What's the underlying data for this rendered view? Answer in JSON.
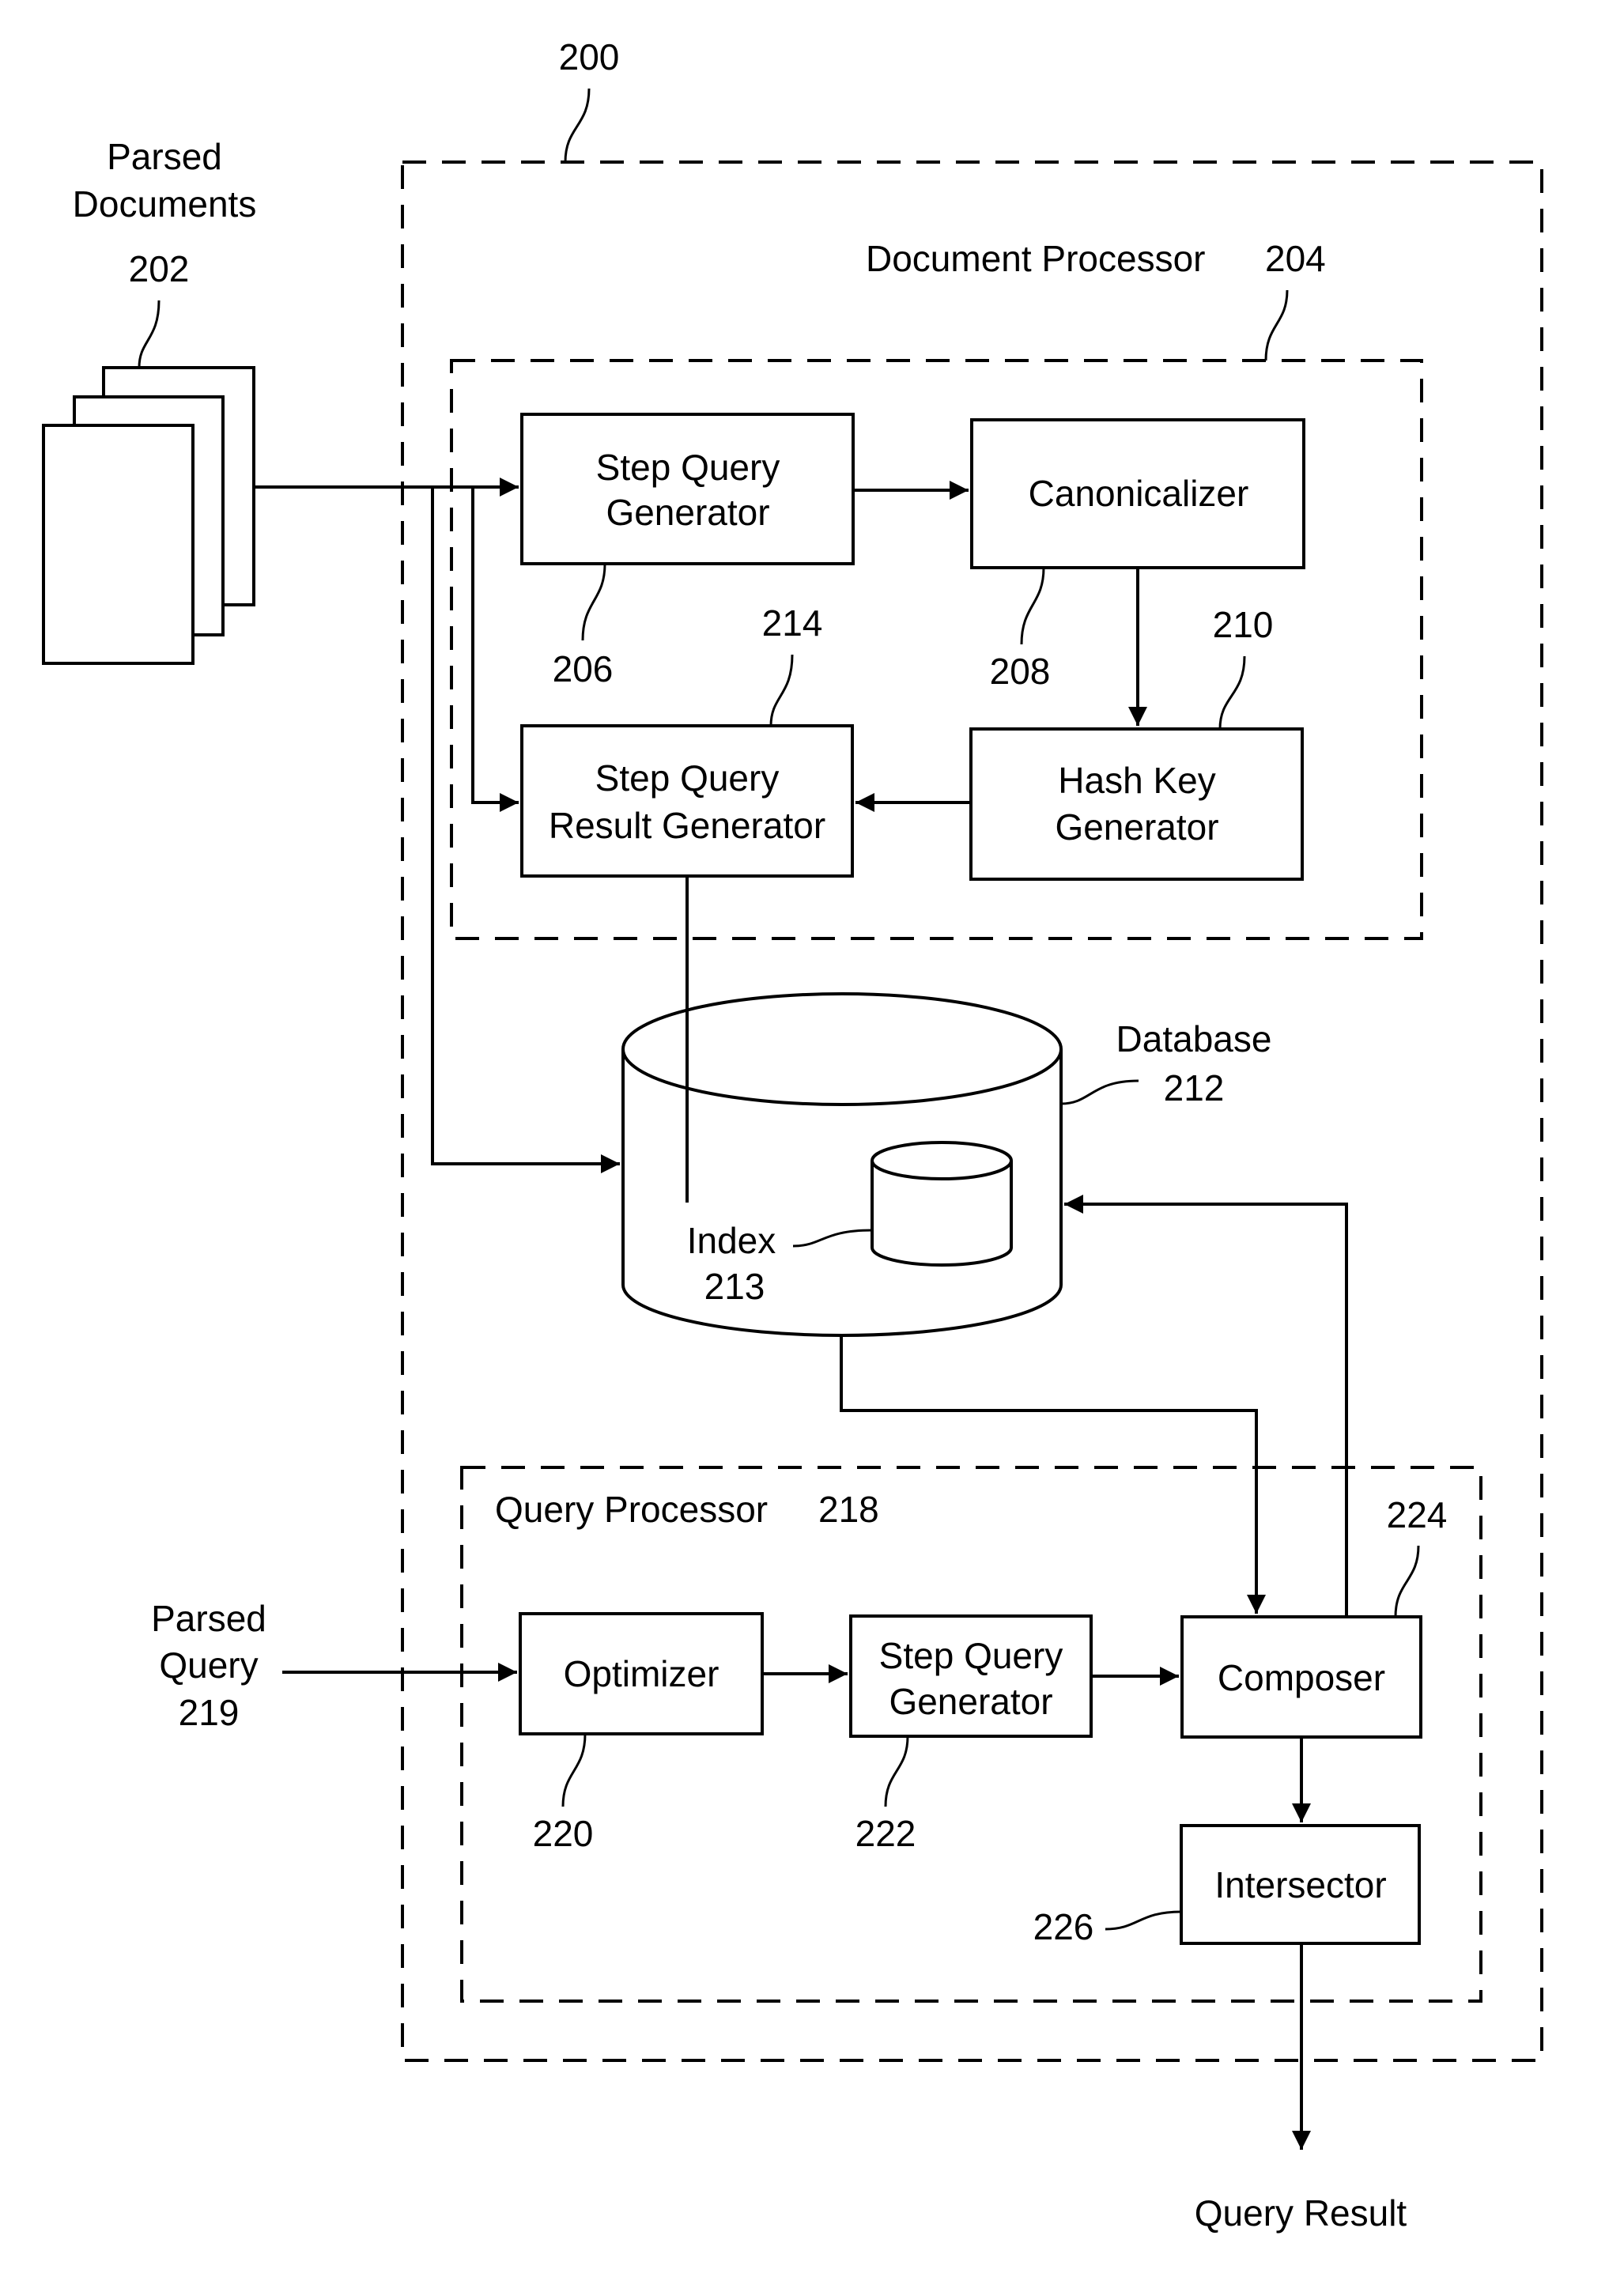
{
  "figure": {
    "system_ref": "200",
    "parsed_documents": {
      "line1": "Parsed",
      "line2": "Documents",
      "ref": "202"
    },
    "document_processor": {
      "label": "Document Processor",
      "ref": "204"
    },
    "step_query_generator_doc": {
      "line1": "Step Query",
      "line2": "Generator",
      "ref": "206"
    },
    "canonicalizer": {
      "label": "Canonicalizer",
      "ref": "208"
    },
    "hash_key_generator": {
      "line1": "Hash Key",
      "line2": "Generator",
      "ref": "210"
    },
    "step_query_result_generator": {
      "line1": "Step Query",
      "line2": "Result Generator",
      "ref": "214"
    },
    "database": {
      "label": "Database",
      "ref": "212"
    },
    "index": {
      "label": "Index",
      "ref": "213"
    },
    "query_processor": {
      "label": "Query Processor",
      "ref": "218"
    },
    "parsed_query": {
      "line1": "Parsed",
      "line2": "Query",
      "ref": "219"
    },
    "optimizer": {
      "label": "Optimizer",
      "ref": "220"
    },
    "step_query_generator_query": {
      "line1": "Step Query",
      "line2": "Generator",
      "ref": "222"
    },
    "composer": {
      "label": "Composer",
      "ref": "224"
    },
    "intersector": {
      "label": "Intersector",
      "ref": "226"
    },
    "query_result": {
      "label": "Query Result"
    }
  }
}
